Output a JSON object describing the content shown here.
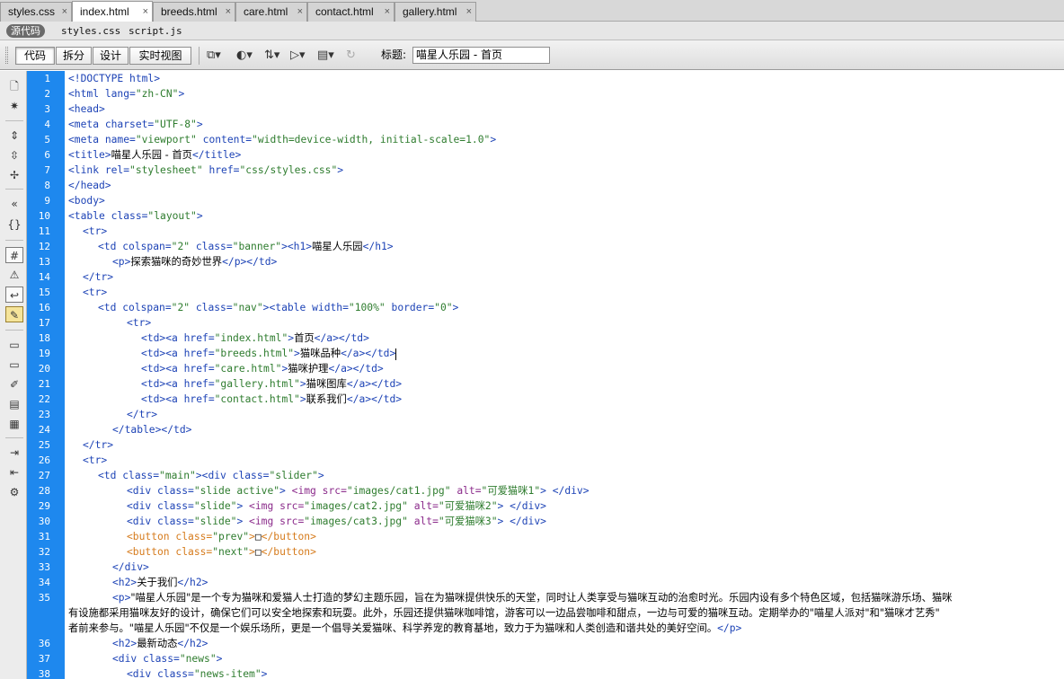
{
  "tabs": [
    {
      "label": "styles.css",
      "active": false
    },
    {
      "label": "index.html",
      "active": true
    },
    {
      "label": "breeds.html",
      "active": false
    },
    {
      "label": "care.html",
      "active": false
    },
    {
      "label": "contact.html",
      "active": false
    },
    {
      "label": "gallery.html",
      "active": false
    }
  ],
  "tab_close_glyph": "×",
  "related": {
    "source_label": "源代码",
    "files": [
      "styles.css",
      "script.js"
    ]
  },
  "toolbar": {
    "views": [
      "代码",
      "拆分",
      "设计",
      "实时视图"
    ],
    "title_label": "标题:",
    "title_value": "喵星人乐园 - 首页",
    "icons": [
      "multiscreen-icon",
      "preview-browser-icon",
      "file-management-icon",
      "validate-markup-icon",
      "visual-aids-icon",
      "refresh-icon"
    ]
  },
  "left_tools": [
    "open-documents-icon",
    "show-code-navigator-icon",
    "collapse-full-tag-icon",
    "collapse-selection-icon",
    "expand-all-icon",
    "select-parent-tag-icon",
    "balance-braces-icon",
    "line-numbers-icon",
    "highlight-invalid-code-icon",
    "word-wrap-icon",
    "syntax-coloring-icon",
    "apply-comment-icon",
    "remove-comment-icon",
    "wrap-tag-icon",
    "recent-snippets-icon",
    "move-css-icon",
    "indent-code-icon",
    "outdent-code-icon",
    "format-source-icon"
  ],
  "colors": {
    "gutter": "#1e88ee",
    "tag": "#1d43b6",
    "value": "#2e7c2e",
    "button_tag": "#d67b1c",
    "img_tag": "#8b2b8b"
  },
  "code": {
    "l1": "<!DOCTYPE html>",
    "l2a": "<html ",
    "l2b": "lang=",
    "l2c": "\"zh-CN\"",
    "l2d": ">",
    "l3": "<head>",
    "l4a": "<meta ",
    "l4b": "charset=",
    "l4c": "\"UTF-8\"",
    "l4d": ">",
    "l5a": "<meta ",
    "l5b": "name=",
    "l5c": "\"viewport\"",
    "l5d": " content=",
    "l5e": "\"width=device-width, initial-scale=1.0\"",
    "l5f": ">",
    "l6a": "<title>",
    "l6b": "喵星人乐园 - 首页",
    "l6c": "</title>",
    "l7a": "<link ",
    "l7b": "rel=",
    "l7c": "\"stylesheet\"",
    "l7d": " href=",
    "l7e": "\"css/styles.css\"",
    "l7f": ">",
    "l8": "</head>",
    "l9": "<body>",
    "l10a": "<table ",
    "l10b": "class=",
    "l10c": "\"layout\"",
    "l10d": ">",
    "l11": "<tr>",
    "l12a": "<td ",
    "l12b": "colspan=",
    "l12c": "\"2\"",
    "l12d": " class=",
    "l12e": "\"banner\"",
    "l12f": "><h1>",
    "l12g": "喵星人乐园",
    "l12h": "</h1>",
    "l13a": "<p>",
    "l13b": "探索猫咪的奇妙世界",
    "l13c": "</p></td>",
    "l14": "</tr>",
    "l15": "<tr>",
    "l16a": "<td ",
    "l16b": "colspan=",
    "l16c": "\"2\"",
    "l16d": " class=",
    "l16e": "\"nav\"",
    "l16f": "><table ",
    "l16g": "width=",
    "l16h": "\"100%\"",
    "l16i": " border=",
    "l16j": "\"0\"",
    "l16k": ">",
    "l17": "<tr>",
    "l18a": "<td><a ",
    "l18b": "href=",
    "l18c": "\"index.html\"",
    "l18d": ">",
    "l18e": "首页",
    "l18f": "</a></td>",
    "l19a": "<td><a ",
    "l19b": "href=",
    "l19c": "\"breeds.html\"",
    "l19d": ">",
    "l19e": "猫咪品种",
    "l19f": "</a></td>",
    "l20a": "<td><a ",
    "l20b": "href=",
    "l20c": "\"care.html\"",
    "l20d": ">",
    "l20e": "猫咪护理",
    "l20f": "</a></td>",
    "l21a": "<td><a ",
    "l21b": "href=",
    "l21c": "\"gallery.html\"",
    "l21d": ">",
    "l21e": "猫咪图库",
    "l21f": "</a></td>",
    "l22a": "<td><a ",
    "l22b": "href=",
    "l22c": "\"contact.html\"",
    "l22d": ">",
    "l22e": "联系我们",
    "l22f": "</a></td>",
    "l23": "</tr>",
    "l24": "</table></td>",
    "l25": "</tr>",
    "l26": "<tr>",
    "l27a": "<td ",
    "l27b": "class=",
    "l27c": "\"main\"",
    "l27d": "><div ",
    "l27e": "class=",
    "l27f": "\"slider\"",
    "l27g": ">",
    "l28a": "<div ",
    "l28b": "class=",
    "l28c": "\"slide active\"",
    "l28d": "> ",
    "l28e": "<img ",
    "l28f": "src=",
    "l28g": "\"images/cat1.jpg\"",
    "l28h": " alt=",
    "l28i": "\"可爱猫咪1\"",
    "l28j": "> </div>",
    "l29a": "<div ",
    "l29b": "class=",
    "l29c": "\"slide\"",
    "l29d": "> ",
    "l29e": "<img ",
    "l29f": "src=",
    "l29g": "\"images/cat2.jpg\"",
    "l29h": " alt=",
    "l29i": "\"可爱猫咪2\"",
    "l29j": "> </div>",
    "l30a": "<div ",
    "l30b": "class=",
    "l30c": "\"slide\"",
    "l30d": "> ",
    "l30e": "<img ",
    "l30f": "src=",
    "l30g": "\"images/cat3.jpg\"",
    "l30h": " alt=",
    "l30i": "\"可爱猫咪3\"",
    "l30j": "> </div>",
    "l31a": "<button ",
    "l31b": "class=",
    "l31c": "\"prev\"",
    "l31d": ">",
    "l31e": "□",
    "l31f": "</button>",
    "l32a": "<button ",
    "l32b": "class=",
    "l32c": "\"next\"",
    "l32d": ">",
    "l32e": "□",
    "l32f": "</button>",
    "l33": "</div>",
    "l34a": "<h2>",
    "l34b": "关于我们",
    "l34c": "</h2>",
    "l35a": "<p>",
    "l35b": "\"喵星人乐园\"是一个专为猫咪和爱猫人士打造的梦幻主题乐园，旨在为猫咪提供快乐的天堂，同时让人类享受与猫咪互动的治愈时光。乐园内设有多个特色区域，包括猫咪游乐场、猫咪",
    "l35w1": "有设施都采用猫咪友好的设计，确保它们可以安全地探索和玩耍。此外，乐园还提供猫咪咖啡馆，游客可以一边品尝咖啡和甜点，一边与可爱的猫咪互动。定期举办的\"喵星人派对\"和\"猫咪才艺秀\"",
    "l35w2a": "者前来参与。\"喵星人乐园\"不仅是一个娱乐场所，更是一个倡导关爱猫咪、科学养宠的教育基地，致力于为猫咪和人类创造和谐共处的美好空间。",
    "l35w2b": "</p>",
    "l36a": "<h2>",
    "l36b": "最新动态",
    "l36c": "</h2>",
    "l37a": "<div ",
    "l37b": "class=",
    "l37c": "\"news\"",
    "l37d": ">",
    "l38a": "<div ",
    "l38b": "class=",
    "l38c": "\"news-item\"",
    "l38d": ">"
  },
  "line_numbers": [
    "1",
    "2",
    "3",
    "4",
    "5",
    "6",
    "7",
    "8",
    "9",
    "10",
    "11",
    "12",
    "13",
    "14",
    "15",
    "16",
    "17",
    "18",
    "19",
    "20",
    "21",
    "22",
    "23",
    "24",
    "25",
    "26",
    "27",
    "28",
    "29",
    "30",
    "31",
    "32",
    "33",
    "34",
    "35",
    "36",
    "37",
    "38"
  ]
}
